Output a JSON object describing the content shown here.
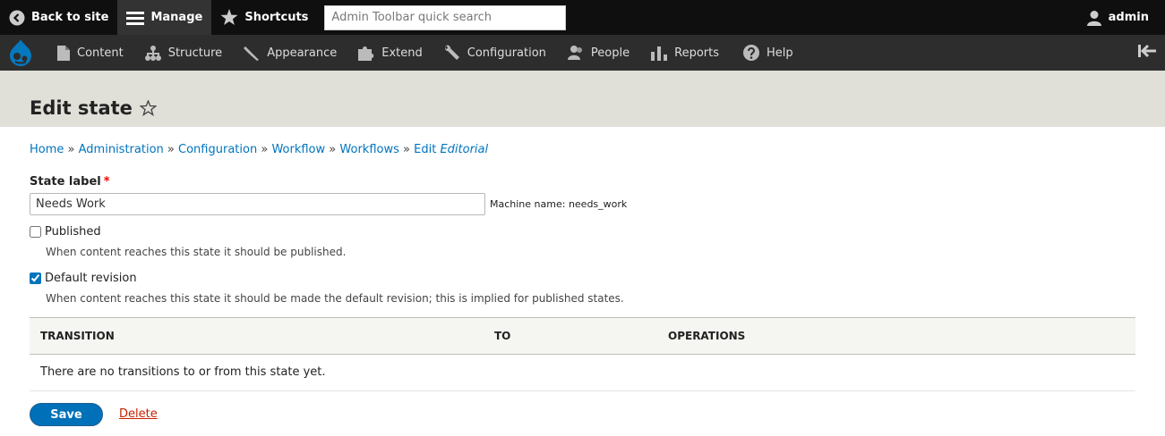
{
  "toolbar": {
    "back_label": "Back to site",
    "manage_label": "Manage",
    "shortcuts_label": "Shortcuts",
    "search_placeholder": "Admin Toolbar quick search",
    "user_label": "admin"
  },
  "tray": {
    "items": [
      {
        "label": "Content",
        "icon": "document-icon"
      },
      {
        "label": "Structure",
        "icon": "structure-icon"
      },
      {
        "label": "Appearance",
        "icon": "paintbrush-icon"
      },
      {
        "label": "Extend",
        "icon": "puzzle-icon"
      },
      {
        "label": "Configuration",
        "icon": "wrench-icon"
      },
      {
        "label": "People",
        "icon": "people-icon"
      },
      {
        "label": "Reports",
        "icon": "bar-chart-icon"
      },
      {
        "label": "Help",
        "icon": "help-icon"
      }
    ]
  },
  "page": {
    "title": "Edit state"
  },
  "breadcrumb": {
    "items": [
      "Home",
      "Administration",
      "Configuration",
      "Workflow",
      "Workflows"
    ],
    "last_prefix": "Edit ",
    "last_emph": "Editorial",
    "separator": "»"
  },
  "form": {
    "state_label": "State label",
    "required_mark": "*",
    "state_value": "Needs Work",
    "machine_name": "Machine name: needs_work",
    "published_label": "Published",
    "published_checked": false,
    "published_desc": "When content reaches this state it should be published.",
    "default_label": "Default revision",
    "default_checked": true,
    "default_desc": "When content reaches this state it should be made the default revision; this is implied for published states."
  },
  "table": {
    "headers": [
      "TRANSITION",
      "TO",
      "OPERATIONS"
    ],
    "empty_text": "There are no transitions to or from this state yet."
  },
  "actions": {
    "save_label": "Save",
    "delete_label": "Delete"
  },
  "colors": {
    "link": "#0074bd",
    "primary_button": "#0071b8",
    "danger_link": "#c72100",
    "toolbar_bg": "#0f0f0f",
    "tray_bg": "#2d2d2d",
    "header_bg": "#e0dfd8"
  }
}
